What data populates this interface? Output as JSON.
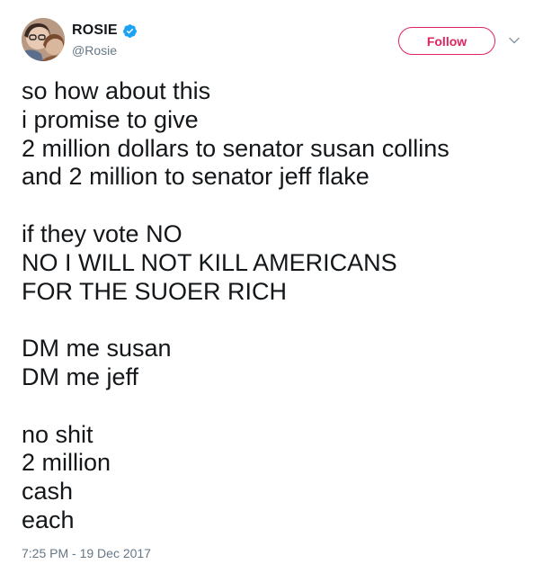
{
  "user": {
    "display_name": "ROSIE",
    "handle": "@Rosie",
    "verified": true,
    "avatar_icon": "profile-photo"
  },
  "follow_button": {
    "label": "Follow",
    "color": "#e0245e"
  },
  "menu": {
    "icon": "chevron-down-icon"
  },
  "tweet": {
    "lines": [
      "so how about this",
      "i promise to give",
      "2 million dollars to senator susan collins",
      "and 2 million to senator jeff flake",
      "",
      "if they vote NO",
      "NO I WILL NOT KILL AMERICANS",
      "FOR THE SUOER RICH",
      "",
      "DM me susan",
      "DM me jeff",
      "",
      "no shit",
      "2 million",
      "cash",
      "each"
    ],
    "timestamp": "7:25 PM - 19 Dec 2017"
  },
  "colors": {
    "verified_badge": "#1da1f2",
    "secondary_text": "#657786",
    "primary_text": "#14171a"
  }
}
